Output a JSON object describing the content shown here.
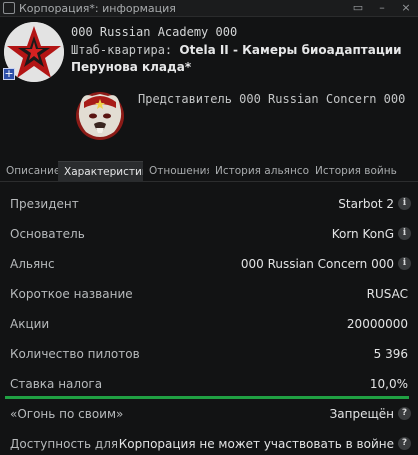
{
  "window": {
    "title": "Корпорация*: информация"
  },
  "corp": {
    "name": "000 Russian Academy 000",
    "hq_prefix": "Штаб-квартира: ",
    "hq_value": "Otela II - Камеры биоадаптации Перунова клада*"
  },
  "alliance": {
    "representative": "Представитель 000 Russian Concern 000"
  },
  "tabs": [
    {
      "label": "Описание"
    },
    {
      "label": "Характеристик"
    },
    {
      "label": "Отношения"
    },
    {
      "label": "История альянсо"
    },
    {
      "label": "История войнь"
    }
  ],
  "rows": [
    {
      "label": "Президент",
      "value": "Starbot 2"
    },
    {
      "label": "Основатель",
      "value": "Korn KonG"
    },
    {
      "label": "Альянс",
      "value": "000 Russian Concern 000"
    },
    {
      "label": "Короткое название",
      "value": "RUSAC"
    },
    {
      "label": "Акции",
      "value": "20000000"
    },
    {
      "label": "Количество пилотов",
      "value": "5 396"
    },
    {
      "label": "Ставка налога",
      "value": "10,0%",
      "level": 0.1
    },
    {
      "label": "«Огонь по своим»",
      "value": "Запрещён"
    },
    {
      "label": "Доступность для уча",
      "value": "Корпорация не может участвовать в войне"
    }
  ],
  "colors": {
    "tax_bar": "#20a143",
    "active_tab": "#2a2c2e"
  }
}
